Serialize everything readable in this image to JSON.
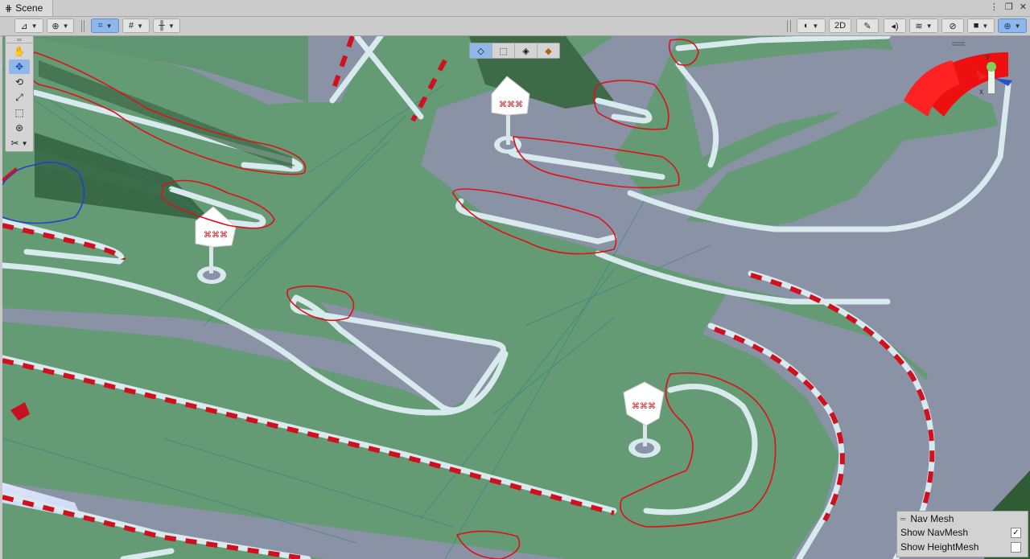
{
  "tab": {
    "title": "Scene",
    "icon": "grid-icon"
  },
  "window_buttons": [
    "menu-icon",
    "maximize-icon",
    "close-icon"
  ],
  "toolbar": {
    "left": [
      {
        "name": "draw-mode-button",
        "icon": "draw-mode-icon"
      },
      {
        "name": "global-local-button",
        "icon": "globe-icon"
      },
      {
        "name": "grid-snap-button",
        "icon": "grid-snap-icon"
      },
      {
        "name": "grid-visibility-button",
        "icon": "grid-visibility-icon"
      },
      {
        "name": "increment-snap-button",
        "icon": "snap-increment-icon"
      }
    ],
    "right": [
      {
        "name": "shading-mode-button",
        "icon": "sphere-icon"
      },
      {
        "name": "toggle-2d-button",
        "label": "2D"
      },
      {
        "name": "lighting-button",
        "icon": "light-bulb-icon"
      },
      {
        "name": "audio-button",
        "icon": "speaker-icon"
      },
      {
        "name": "effects-button",
        "icon": "layers-icon"
      },
      {
        "name": "hidden-objects-button",
        "icon": "eye-slash-icon"
      },
      {
        "name": "camera-button",
        "icon": "camera-icon"
      },
      {
        "name": "gizmos-button",
        "icon": "gizmo-icon"
      }
    ],
    "toggle_2d_label": "2D"
  },
  "tools": [
    {
      "name": "hand-tool",
      "icon": "hand-icon",
      "active": false
    },
    {
      "name": "move-tool",
      "icon": "move-icon",
      "active": true
    },
    {
      "name": "rotate-tool",
      "icon": "rotate-icon",
      "active": false
    },
    {
      "name": "scale-tool",
      "icon": "scale-icon",
      "active": false
    },
    {
      "name": "rect-tool",
      "icon": "rect-icon",
      "active": false
    },
    {
      "name": "transform-tool",
      "icon": "transform-icon",
      "active": false
    },
    {
      "name": "custom-tool",
      "icon": "custom-tool-icon",
      "active": false
    }
  ],
  "view_modes": [
    "cube-icon",
    "rect-select-icon",
    "wire-cube-icon",
    "shaded-cube-icon"
  ],
  "navmesh_panel": {
    "title": "Nav Mesh",
    "show_navmesh_label": "Show NavMesh",
    "show_navmesh_checked": true,
    "show_heightmesh_label": "Show HeightMesh",
    "show_heightmesh_checked": false
  },
  "gizmo": {
    "x_label": "x",
    "y_label": "y"
  },
  "colors": {
    "navmesh_green": "#649a74",
    "road": "#8a93a6",
    "curb_white": "#dce9ee",
    "kerb_red": "#d0101e",
    "annotation_red": "#e0101a",
    "annotation_blue": "#2040d0",
    "active_tool": "#8fb7ea"
  }
}
